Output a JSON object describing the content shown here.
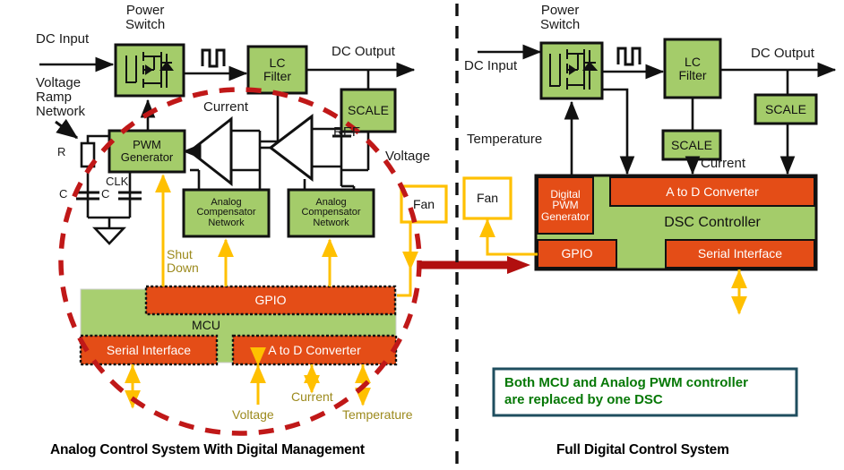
{
  "colors": {
    "green_block": "#a4cc6a",
    "orange_block": "#e44d17",
    "mcu_green": "#a8cf70",
    "dashed_oval": "#c01818",
    "red_arrow": "#b10f0f",
    "yellow": "#ffc000",
    "gold_text": "#9c8a1d",
    "note_border": "#1f4e5f",
    "note_text": "#067806",
    "divider": "#111111"
  },
  "left_panel": {
    "caption": "Analog Control System With Digital Management",
    "labels": {
      "dc_input": "DC Input",
      "power_switch": "Power\nSwitch",
      "dc_output": "DC Output",
      "voltage_ramp_network": "Voltage\nRamp\nNetwork",
      "r": "R",
      "c1": "C",
      "c2": "C",
      "clk": "CLK",
      "current_top": "Current",
      "ref": "REF",
      "voltage_right": "Voltage",
      "shut_down": "Shut\nDown",
      "voltage_bottom": "Voltage",
      "current_bottom": "Current",
      "temperature_bottom": "Temperature"
    },
    "blocks": {
      "power_switch": "",
      "lc_filter": "LC\nFilter",
      "scale": "SCALE",
      "pwm_generator": "PWM\nGenerator",
      "analog_comp_1": "Analog\nCompensator\nNetwork",
      "analog_comp_2": "Analog\nCompensator\nNetwork",
      "fan": "Fan",
      "mcu": "MCU",
      "gpio": "GPIO",
      "serial_interface": "Serial Interface",
      "a_to_d": "A to D Converter"
    }
  },
  "right_panel": {
    "caption": "Full Digital Control System",
    "labels": {
      "dc_input": "DC Input",
      "power_switch": "Power\nSwitch",
      "dc_output": "DC Output",
      "temperature": "Temperature",
      "current": "Current"
    },
    "blocks": {
      "lc_filter": "LC\nFilter",
      "scale_out": "SCALE",
      "scale_current": "SCALE",
      "fan": "Fan",
      "digital_pwm_generator": "Digital\nPWM\nGenerator",
      "a_to_d": "A to D Converter",
      "dsc_controller": "DSC Controller",
      "gpio": "GPIO",
      "serial_interface": "Serial Interface"
    },
    "note": "Both MCU and Analog PWM controller\nare replaced by one DSC"
  }
}
